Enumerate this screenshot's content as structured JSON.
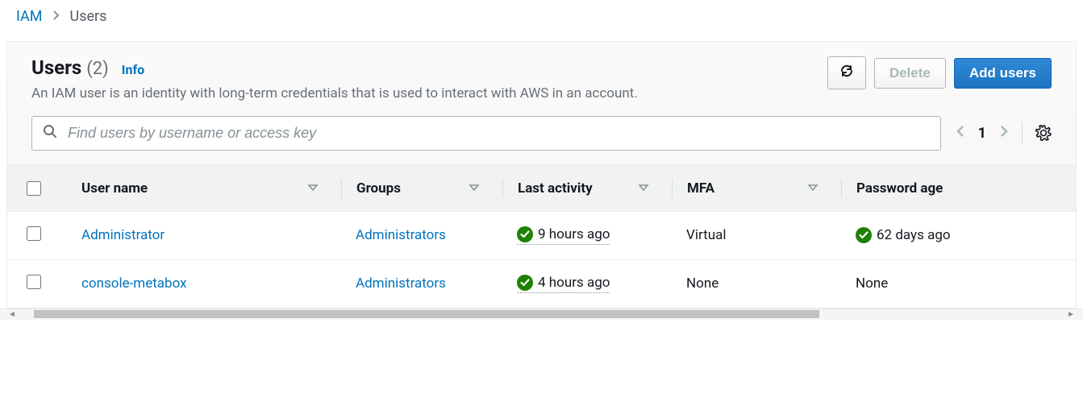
{
  "breadcrumb": {
    "root": "IAM",
    "current": "Users"
  },
  "header": {
    "title": "Users",
    "count": "(2)",
    "info_label": "Info",
    "description": "An IAM user is an identity with long-term credentials that is used to interact with AWS in an account."
  },
  "actions": {
    "delete": "Delete",
    "add": "Add users"
  },
  "search": {
    "placeholder": "Find users by username or access key"
  },
  "pagination": {
    "page": "1"
  },
  "table": {
    "columns": {
      "user": "User name",
      "groups": "Groups",
      "activity": "Last activity",
      "mfa": "MFA",
      "password": "Password age"
    },
    "rows": [
      {
        "user": "Administrator",
        "groups": "Administrators",
        "activity": "9 hours ago",
        "activity_ok": true,
        "mfa": "Virtual",
        "password": "62 days ago",
        "password_ok": true
      },
      {
        "user": "console-metabox",
        "groups": "Administrators",
        "activity": "4 hours ago",
        "activity_ok": true,
        "mfa": "None",
        "password": "None",
        "password_ok": false
      }
    ]
  }
}
